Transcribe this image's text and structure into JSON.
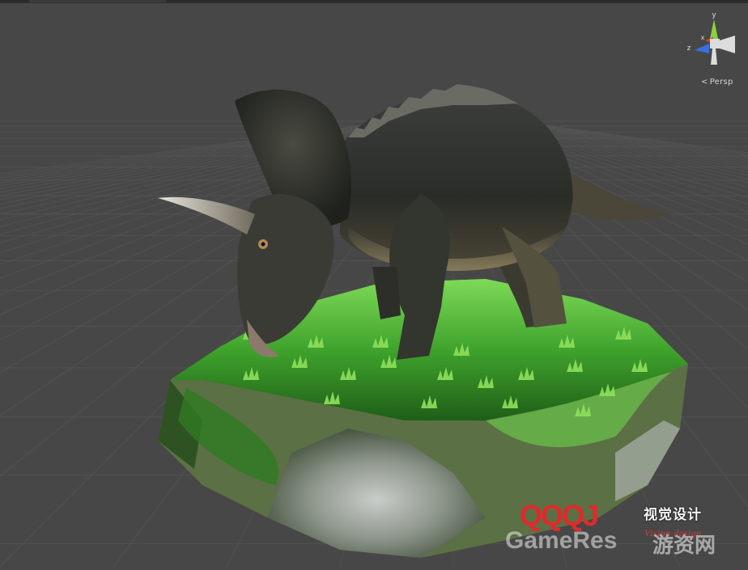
{
  "viewport": {
    "camera_mode_label": "Persp",
    "background_color": "#474747",
    "grid_color": "#5a5a5a"
  },
  "gizmo": {
    "axis_y_label": "y",
    "axis_x_label": "x",
    "axis_z_label": "z",
    "axis_y_color": "#8bd140",
    "axis_x_color": "#db3a2a",
    "axis_z_color": "#3a6fe0",
    "center_color": "#dcdcdc"
  },
  "scene_object": {
    "icon": "triceratops-model-icon"
  },
  "watermark": {
    "logo_text": "QQQJ",
    "cn_text": "视觉设计",
    "en_text": "Vision  design",
    "site_text": "GameRes",
    "site_cn_text": "游资网",
    "brand_color": "#e02a2a"
  }
}
